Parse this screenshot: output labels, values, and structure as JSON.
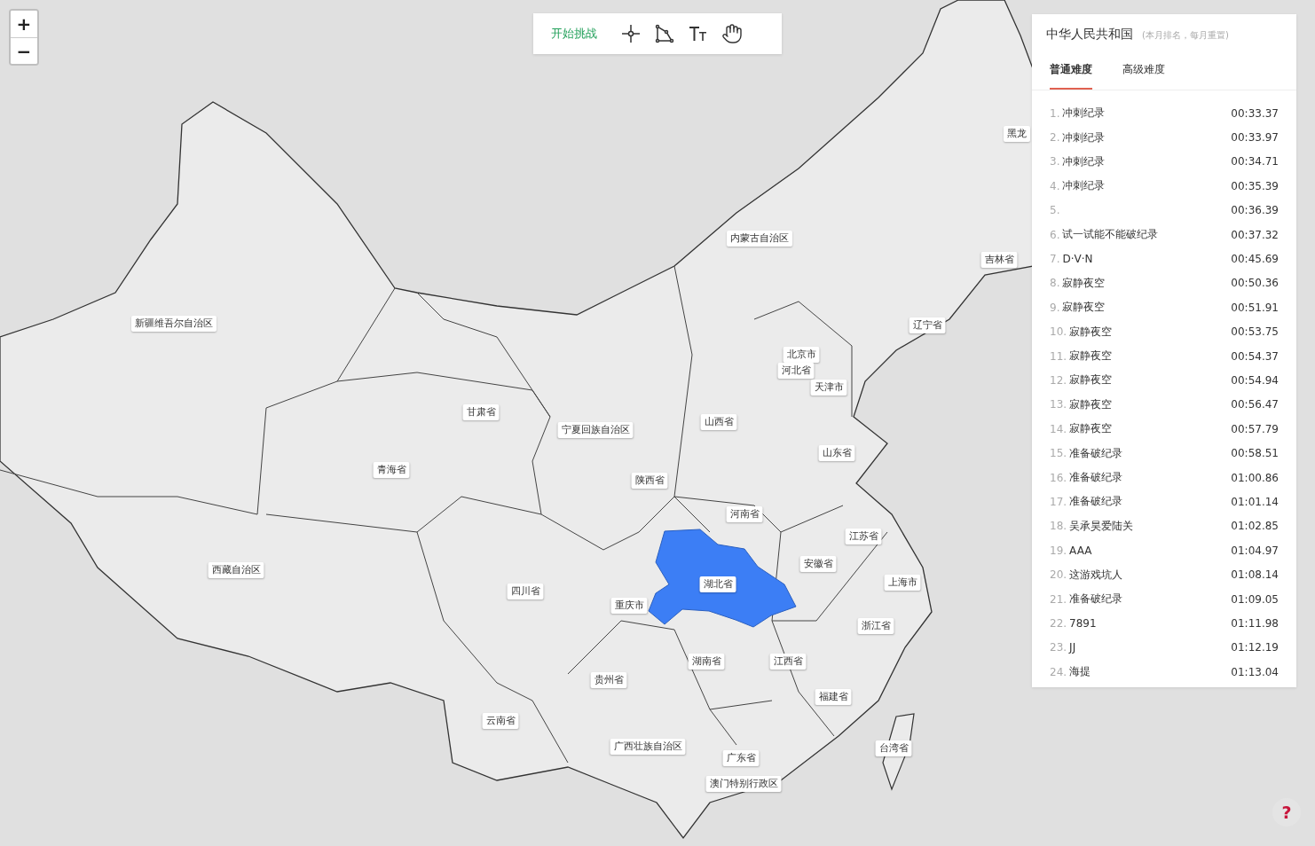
{
  "zoom": {
    "in": "+",
    "out": "−"
  },
  "toolbar": {
    "start_button": "开始挑战"
  },
  "map": {
    "provinces": [
      {
        "name": "新疆维吾尔自治区",
        "selected": false
      },
      {
        "name": "西藏自治区",
        "selected": false
      },
      {
        "name": "青海省",
        "selected": false
      },
      {
        "name": "甘肃省",
        "selected": false
      },
      {
        "name": "宁夏回族自治区",
        "selected": false
      },
      {
        "name": "内蒙古自治区",
        "selected": false
      },
      {
        "name": "黑龙",
        "selected": false
      },
      {
        "name": "吉林省",
        "selected": false
      },
      {
        "name": "辽宁省",
        "selected": false
      },
      {
        "name": "北京市",
        "selected": false
      },
      {
        "name": "河北省",
        "selected": false
      },
      {
        "name": "天津市",
        "selected": false
      },
      {
        "name": "山西省",
        "selected": false
      },
      {
        "name": "山东省",
        "selected": false
      },
      {
        "name": "陕西省",
        "selected": false
      },
      {
        "name": "河南省",
        "selected": false
      },
      {
        "name": "江苏省",
        "selected": false
      },
      {
        "name": "安徽省",
        "selected": false
      },
      {
        "name": "上海市",
        "selected": false
      },
      {
        "name": "湖北省",
        "selected": true
      },
      {
        "name": "四川省",
        "selected": false
      },
      {
        "name": "重庆市",
        "selected": false
      },
      {
        "name": "浙江省",
        "selected": false
      },
      {
        "name": "湖南省",
        "selected": false
      },
      {
        "name": "江西省",
        "selected": false
      },
      {
        "name": "贵州省",
        "selected": false
      },
      {
        "name": "福建省",
        "selected": false
      },
      {
        "name": "云南省",
        "selected": false
      },
      {
        "name": "广西壮族自治区",
        "selected": false
      },
      {
        "name": "广东省",
        "selected": false
      },
      {
        "name": "澳门特别行政区",
        "selected": false
      },
      {
        "name": "台湾省",
        "selected": false
      }
    ]
  },
  "leaderboard": {
    "title": "中华人民共和国",
    "subtitle": "(本月排名，每月重置)",
    "tabs": [
      {
        "label": "普通难度",
        "selected": true
      },
      {
        "label": "高级难度",
        "selected": false
      }
    ],
    "rows": [
      {
        "rank": "1.",
        "name": "冲刺纪录",
        "time": "00:33.37"
      },
      {
        "rank": "2.",
        "name": "冲刺纪录",
        "time": "00:33.97"
      },
      {
        "rank": "3.",
        "name": "冲刺纪录",
        "time": "00:34.71"
      },
      {
        "rank": "4.",
        "name": "冲刺纪录",
        "time": "00:35.39"
      },
      {
        "rank": "5.",
        "time": "00:36.39"
      },
      {
        "rank": "6.",
        "name": "试一试能不能破纪录",
        "time": "00:37.32"
      },
      {
        "rank": "7.",
        "name": "D·V·N",
        "time": "00:45.69"
      },
      {
        "rank": "8.",
        "name": "寂静夜空",
        "time": "00:50.36"
      },
      {
        "rank": "9.",
        "name": "寂静夜空",
        "time": "00:51.91"
      },
      {
        "rank": "10.",
        "name": "寂静夜空",
        "time": "00:53.75"
      },
      {
        "rank": "11.",
        "name": "寂静夜空",
        "time": "00:54.37"
      },
      {
        "rank": "12.",
        "name": "寂静夜空",
        "time": "00:54.94"
      },
      {
        "rank": "13.",
        "name": "寂静夜空",
        "time": "00:56.47"
      },
      {
        "rank": "14.",
        "name": "寂静夜空",
        "time": "00:57.79"
      },
      {
        "rank": "15.",
        "name": "准备破纪录",
        "time": "00:58.51"
      },
      {
        "rank": "16.",
        "name": "准备破纪录",
        "time": "01:00.86"
      },
      {
        "rank": "17.",
        "name": "准备破纪录",
        "time": "01:01.14"
      },
      {
        "rank": "18.",
        "name": "吴承昊爱陆关",
        "time": "01:02.85"
      },
      {
        "rank": "19.",
        "name": "AAA",
        "time": "01:04.97"
      },
      {
        "rank": "20.",
        "name": "这游戏坑人",
        "time": "01:08.14"
      },
      {
        "rank": "21.",
        "name": "准备破纪录",
        "time": "01:09.05"
      },
      {
        "rank": "22.",
        "name": "7891",
        "time": "01:11.98"
      },
      {
        "rank": "23.",
        "name": "JJ",
        "time": "01:12.19"
      },
      {
        "rank": "24.",
        "name": "海提",
        "time": "01:13.04"
      }
    ]
  },
  "help": {
    "label": "?"
  }
}
